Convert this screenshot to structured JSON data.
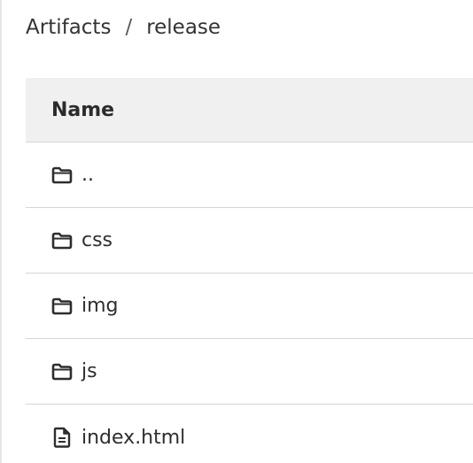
{
  "breadcrumb": {
    "root": "Artifacts",
    "separator": "/",
    "current": "release"
  },
  "table": {
    "header": {
      "name": "Name"
    },
    "rows": [
      {
        "label": "..",
        "icon": "folder-icon"
      },
      {
        "label": "css",
        "icon": "folder-icon"
      },
      {
        "label": "img",
        "icon": "folder-icon"
      },
      {
        "label": "js",
        "icon": "folder-icon"
      },
      {
        "label": "index.html",
        "icon": "file-icon"
      }
    ]
  }
}
